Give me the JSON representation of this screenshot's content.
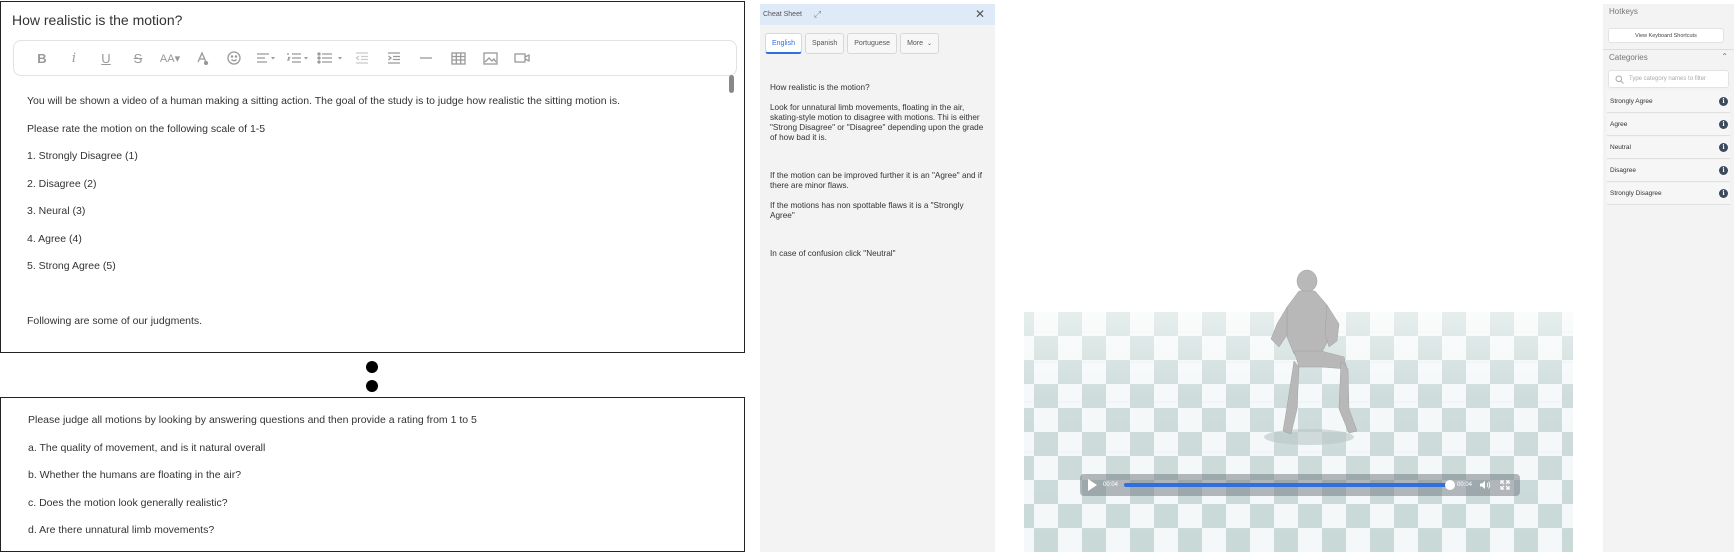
{
  "editor": {
    "title": "How realistic is the motion?",
    "toolbar": [
      "bold-icon",
      "italic-icon",
      "underline-icon",
      "strikethrough-icon",
      "font-size-icon",
      "font-color-icon",
      "emoji-icon",
      "align-icon",
      "ordered-list-icon",
      "bullet-list-icon",
      "outdent-icon",
      "indent-icon",
      "horizontal-rule-icon",
      "table-icon",
      "image-icon",
      "video-icon"
    ],
    "paragraphs": [
      "You will be shown a video of a human making a sitting action. The goal of the study is to judge how realistic the sitting motion is.",
      "Please rate the motion on the following scale of 1-5",
      "1. Strongly Disagree (1)",
      "2. Disagree (2)",
      "3. Neural (3)",
      "4. Agree (4)",
      "5. Strong Agree (5)",
      "Following are some of our judgments."
    ]
  },
  "lower": {
    "paragraphs": [
      "Please judge all motions by looking by answering questions and then provide a rating from 1 to 5",
      "a. The quality of movement, and is it natural overall",
      "b. Whether the humans are floating in the air?",
      "c. Does the motion look generally realistic?",
      "d. Are there unnatural limb movements?"
    ]
  },
  "cheat_sheet": {
    "title": "Cheat Sheet",
    "tabs": [
      "English",
      "Spanish",
      "Portuguese",
      "More"
    ],
    "active_tab": "English",
    "paragraphs": [
      "How realistic is the motion?",
      "Look for unnatural limb movements, floating in the air, skating-style motion to disagree with motions. Thi is either \"Strong Disagree\" or \"Disagree\" depending upon the grade of how bad it is.",
      "If the motion can be improved further it is an \"Agree\" and if there are minor flaws.",
      "If the motions has non spottable flaws it is a \"Strongly Agree\"",
      "In case of confusion click \"Neutral\""
    ]
  },
  "video": {
    "current_time": "00:04",
    "duration": "00:04",
    "progress": 1.0
  },
  "sidebar": {
    "hotkeys_title": "Hotkeys",
    "keyboard_button": "View Keyboard Shortcuts",
    "categories_title": "Categories",
    "search_placeholder": "Type category names to filter",
    "categories": [
      "Strongly Agree",
      "Agree",
      "Neutral",
      "Disagree",
      "Strongly Disagree"
    ]
  },
  "colors": {
    "accent": "#2f6fde",
    "floor_light": "#f4f8f8",
    "floor_dark": "#c9d9d8"
  }
}
